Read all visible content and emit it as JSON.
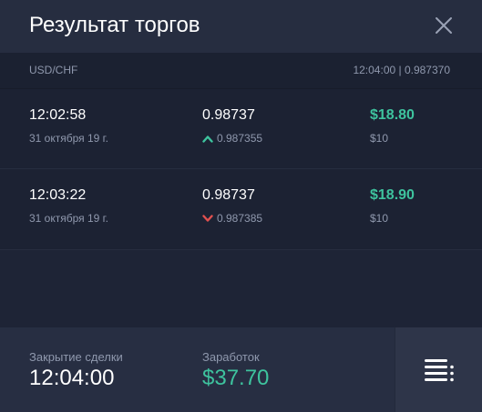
{
  "header": {
    "title": "Результат торгов"
  },
  "subheader": {
    "pair": "USD/CHF",
    "time_price": "12:04:00 | 0.987370"
  },
  "trades": [
    {
      "time": "12:02:58",
      "date": "31 октября 19 г.",
      "price": "0.98737",
      "open_price": "0.987355",
      "direction": "up",
      "payout": "$18.80",
      "stake": "$10"
    },
    {
      "time": "12:03:22",
      "date": "31 октября 19 г.",
      "price": "0.98737",
      "open_price": "0.987385",
      "direction": "down",
      "payout": "$18.90",
      "stake": "$10"
    }
  ],
  "footer": {
    "close_label": "Закрытие сделки",
    "close_time": "12:04:00",
    "earned_label": "Заработок",
    "earned_value": "$37.70"
  },
  "colors": {
    "profit": "#3ec39e",
    "up": "#3ec39e",
    "down": "#e0504f",
    "muted": "#8f98ad"
  }
}
